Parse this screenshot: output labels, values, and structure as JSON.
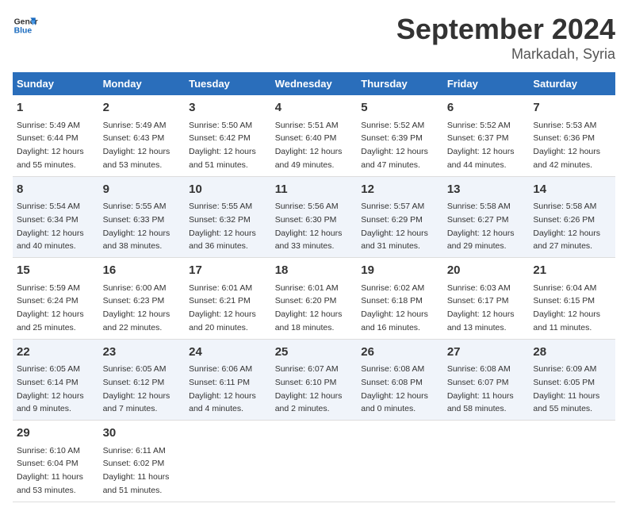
{
  "header": {
    "logo_line1": "General",
    "logo_line2": "Blue",
    "month": "September 2024",
    "location": "Markadah, Syria"
  },
  "days_of_week": [
    "Sunday",
    "Monday",
    "Tuesday",
    "Wednesday",
    "Thursday",
    "Friday",
    "Saturday"
  ],
  "weeks": [
    [
      {
        "day": "1",
        "info": "Sunrise: 5:49 AM\nSunset: 6:44 PM\nDaylight: 12 hours\nand 55 minutes."
      },
      {
        "day": "2",
        "info": "Sunrise: 5:49 AM\nSunset: 6:43 PM\nDaylight: 12 hours\nand 53 minutes."
      },
      {
        "day": "3",
        "info": "Sunrise: 5:50 AM\nSunset: 6:42 PM\nDaylight: 12 hours\nand 51 minutes."
      },
      {
        "day": "4",
        "info": "Sunrise: 5:51 AM\nSunset: 6:40 PM\nDaylight: 12 hours\nand 49 minutes."
      },
      {
        "day": "5",
        "info": "Sunrise: 5:52 AM\nSunset: 6:39 PM\nDaylight: 12 hours\nand 47 minutes."
      },
      {
        "day": "6",
        "info": "Sunrise: 5:52 AM\nSunset: 6:37 PM\nDaylight: 12 hours\nand 44 minutes."
      },
      {
        "day": "7",
        "info": "Sunrise: 5:53 AM\nSunset: 6:36 PM\nDaylight: 12 hours\nand 42 minutes."
      }
    ],
    [
      {
        "day": "8",
        "info": "Sunrise: 5:54 AM\nSunset: 6:34 PM\nDaylight: 12 hours\nand 40 minutes."
      },
      {
        "day": "9",
        "info": "Sunrise: 5:55 AM\nSunset: 6:33 PM\nDaylight: 12 hours\nand 38 minutes."
      },
      {
        "day": "10",
        "info": "Sunrise: 5:55 AM\nSunset: 6:32 PM\nDaylight: 12 hours\nand 36 minutes."
      },
      {
        "day": "11",
        "info": "Sunrise: 5:56 AM\nSunset: 6:30 PM\nDaylight: 12 hours\nand 33 minutes."
      },
      {
        "day": "12",
        "info": "Sunrise: 5:57 AM\nSunset: 6:29 PM\nDaylight: 12 hours\nand 31 minutes."
      },
      {
        "day": "13",
        "info": "Sunrise: 5:58 AM\nSunset: 6:27 PM\nDaylight: 12 hours\nand 29 minutes."
      },
      {
        "day": "14",
        "info": "Sunrise: 5:58 AM\nSunset: 6:26 PM\nDaylight: 12 hours\nand 27 minutes."
      }
    ],
    [
      {
        "day": "15",
        "info": "Sunrise: 5:59 AM\nSunset: 6:24 PM\nDaylight: 12 hours\nand 25 minutes."
      },
      {
        "day": "16",
        "info": "Sunrise: 6:00 AM\nSunset: 6:23 PM\nDaylight: 12 hours\nand 22 minutes."
      },
      {
        "day": "17",
        "info": "Sunrise: 6:01 AM\nSunset: 6:21 PM\nDaylight: 12 hours\nand 20 minutes."
      },
      {
        "day": "18",
        "info": "Sunrise: 6:01 AM\nSunset: 6:20 PM\nDaylight: 12 hours\nand 18 minutes."
      },
      {
        "day": "19",
        "info": "Sunrise: 6:02 AM\nSunset: 6:18 PM\nDaylight: 12 hours\nand 16 minutes."
      },
      {
        "day": "20",
        "info": "Sunrise: 6:03 AM\nSunset: 6:17 PM\nDaylight: 12 hours\nand 13 minutes."
      },
      {
        "day": "21",
        "info": "Sunrise: 6:04 AM\nSunset: 6:15 PM\nDaylight: 12 hours\nand 11 minutes."
      }
    ],
    [
      {
        "day": "22",
        "info": "Sunrise: 6:05 AM\nSunset: 6:14 PM\nDaylight: 12 hours\nand 9 minutes."
      },
      {
        "day": "23",
        "info": "Sunrise: 6:05 AM\nSunset: 6:12 PM\nDaylight: 12 hours\nand 7 minutes."
      },
      {
        "day": "24",
        "info": "Sunrise: 6:06 AM\nSunset: 6:11 PM\nDaylight: 12 hours\nand 4 minutes."
      },
      {
        "day": "25",
        "info": "Sunrise: 6:07 AM\nSunset: 6:10 PM\nDaylight: 12 hours\nand 2 minutes."
      },
      {
        "day": "26",
        "info": "Sunrise: 6:08 AM\nSunset: 6:08 PM\nDaylight: 12 hours\nand 0 minutes."
      },
      {
        "day": "27",
        "info": "Sunrise: 6:08 AM\nSunset: 6:07 PM\nDaylight: 11 hours\nand 58 minutes."
      },
      {
        "day": "28",
        "info": "Sunrise: 6:09 AM\nSunset: 6:05 PM\nDaylight: 11 hours\nand 55 minutes."
      }
    ],
    [
      {
        "day": "29",
        "info": "Sunrise: 6:10 AM\nSunset: 6:04 PM\nDaylight: 11 hours\nand 53 minutes."
      },
      {
        "day": "30",
        "info": "Sunrise: 6:11 AM\nSunset: 6:02 PM\nDaylight: 11 hours\nand 51 minutes."
      },
      {
        "day": "",
        "info": ""
      },
      {
        "day": "",
        "info": ""
      },
      {
        "day": "",
        "info": ""
      },
      {
        "day": "",
        "info": ""
      },
      {
        "day": "",
        "info": ""
      }
    ]
  ]
}
